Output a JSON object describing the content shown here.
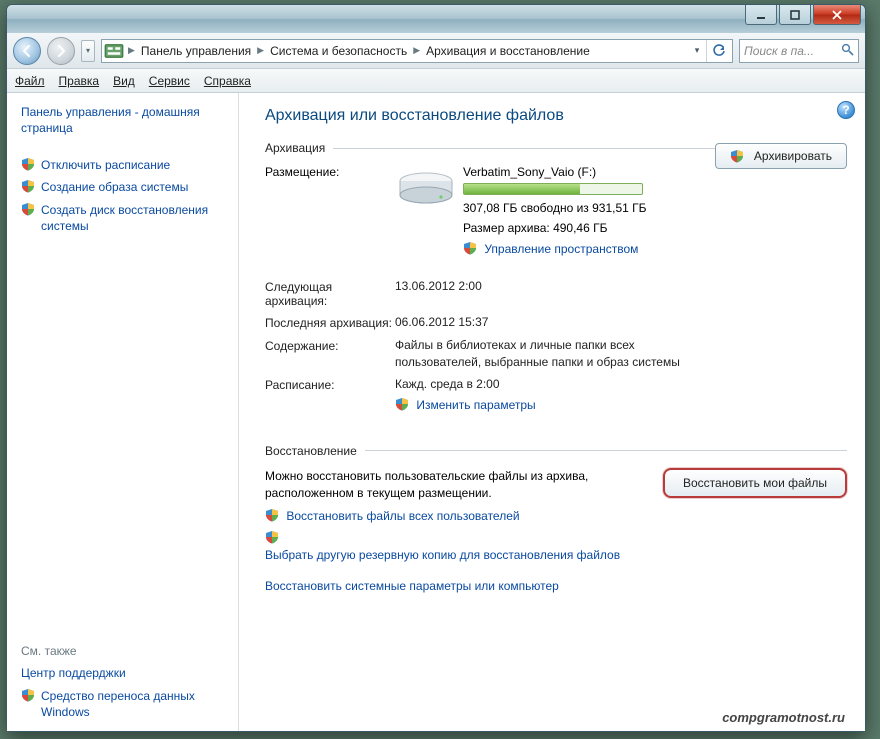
{
  "breadcrumbs": {
    "seg1": "Панель управления",
    "seg2": "Система и безопасность",
    "seg3": "Архивация и восстановление"
  },
  "search": {
    "placeholder": "Поиск в па..."
  },
  "menu": {
    "file": "Файл",
    "edit": "Правка",
    "view": "Вид",
    "service": "Сервис",
    "help": "Справка"
  },
  "sidebar": {
    "home": "Панель управления - домашняя страница",
    "items": [
      "Отключить расписание",
      "Создание образа системы",
      "Создать диск восстановления системы"
    ],
    "seealso_label": "См. также",
    "seealso": {
      "support": "Центр поддерджки",
      "transfer": "Средство переноса данных Windows"
    }
  },
  "page": {
    "title": "Архивация или восстановление файлов",
    "section_backup": "Архивация",
    "section_restore": "Восстановление",
    "backup_button": "Архивировать",
    "location_label": "Размещение:",
    "location_value": "Verbatim_Sony_Vaio (F:)",
    "free_space": "307,08 ГБ свободно из 931,51 ГБ",
    "archive_size": "Размер архива: 490,46 ГБ",
    "manage_space": "Управление пространством",
    "next_label": "Следующая архивация:",
    "next_value": "13.06.2012 2:00",
    "last_label": "Последняя архивация:",
    "last_value": "06.06.2012 15:37",
    "content_label": "Содержание:",
    "content_value": "Файлы в библиотеках и личные папки всех пользователей, выбранные папки и образ системы",
    "schedule_label": "Расписание:",
    "schedule_value": "Кажд. среда в 2:00",
    "change_params": "Изменить параметры",
    "restore_desc": "Можно восстановить пользовательские файлы из архива, расположенном в текущем размещении.",
    "restore_button": "Восстановить мои файлы",
    "restore_all": "Восстановить файлы всех пользователей",
    "pick_other": "Выбрать другую резервную копию для восстановления файлов",
    "restore_system": "Восстановить системные параметры или компьютер"
  },
  "progress_pct": 65,
  "watermark": "compgramotnost.ru"
}
